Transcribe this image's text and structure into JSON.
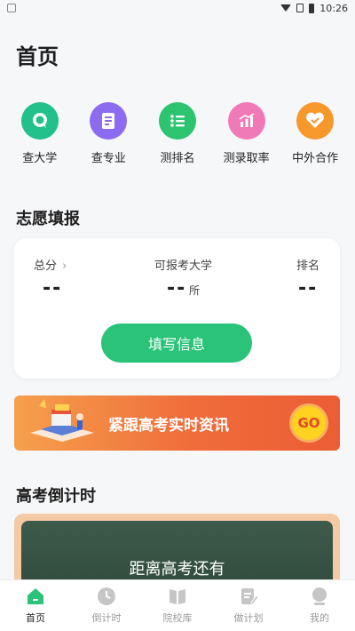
{
  "status_bar": {
    "time": "10:26"
  },
  "page_title": "首页",
  "quick_entries": [
    {
      "label": "查大学",
      "icon": "search-bubble-icon",
      "color": "#22c08a"
    },
    {
      "label": "查专业",
      "icon": "document-icon",
      "color": "#8b6cf0"
    },
    {
      "label": "测排名",
      "icon": "list-icon",
      "color": "#2cc46f"
    },
    {
      "label": "测录取率",
      "icon": "bar-chart-icon",
      "color": "#f07ab8"
    },
    {
      "label": "中外合作",
      "icon": "heart-handshake-icon",
      "color": "#f7982c"
    }
  ],
  "volunteer": {
    "title": "志愿填报",
    "total_score_label": "总分",
    "total_score_value": "--",
    "colleges_label": "可报考大学",
    "colleges_value": "--",
    "colleges_unit": "所",
    "rank_label": "排名",
    "rank_value": "--",
    "fill_button": "填写信息"
  },
  "banner": {
    "text": "紧跟高考实时资讯",
    "go": "GO"
  },
  "countdown": {
    "title": "高考倒计时",
    "board_text": "距离高考还有"
  },
  "tabs": [
    {
      "label": "首页",
      "icon": "home-icon",
      "active": true
    },
    {
      "label": "倒计时",
      "icon": "clock-icon",
      "active": false
    },
    {
      "label": "院校库",
      "icon": "book-icon",
      "active": false
    },
    {
      "label": "做计划",
      "icon": "edit-note-icon",
      "active": false
    },
    {
      "label": "我的",
      "icon": "profile-icon",
      "active": false
    }
  ],
  "colors": {
    "accent": "#2bc379",
    "tab_inactive": "#c6c6c6"
  }
}
